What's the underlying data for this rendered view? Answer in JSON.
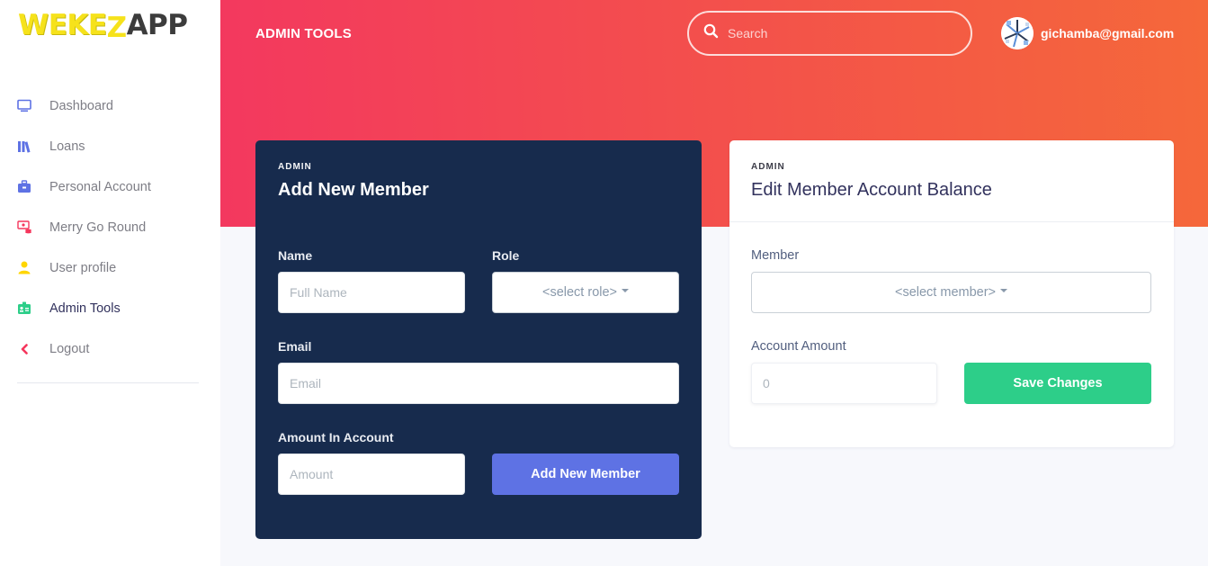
{
  "brand": {
    "part1": "WEKE",
    "part2": "Z",
    "part3": "APP"
  },
  "sidebar": {
    "items": [
      {
        "label": "Dashboard",
        "icon": "monitor-icon",
        "color": "#5e72e4"
      },
      {
        "label": "Loans",
        "icon": "books-icon",
        "color": "#5e72e4"
      },
      {
        "label": "Personal Account",
        "icon": "briefcase-icon",
        "color": "#5e72e4"
      },
      {
        "label": "Merry Go Round",
        "icon": "money-icon",
        "color": "#f5365c"
      },
      {
        "label": "User profile",
        "icon": "user-icon",
        "color": "#ffd600"
      },
      {
        "label": "Admin Tools",
        "icon": "id-card-icon",
        "color": "#2dce89"
      },
      {
        "label": "Logout",
        "icon": "chevron-left-icon",
        "color": "#f5365c"
      }
    ],
    "active": "Admin Tools"
  },
  "header": {
    "title": "ADMIN TOOLS",
    "search_placeholder": "Search",
    "user_email": "gichamba@gmail.com"
  },
  "add_member": {
    "eyebrow": "ADMIN",
    "title": "Add New Member",
    "name_label": "Name",
    "name_placeholder": "Full Name",
    "role_label": "Role",
    "role_selected": "<select role>",
    "email_label": "Email",
    "email_placeholder": "Email",
    "amount_label": "Amount In Account",
    "amount_placeholder": "Amount",
    "submit_label": "Add New Member"
  },
  "edit_balance": {
    "eyebrow": "ADMIN",
    "title": "Edit Member Account Balance",
    "member_label": "Member",
    "member_selected": "<select member>",
    "amount_label": "Account Amount",
    "amount_placeholder": "0",
    "save_label": "Save Changes"
  },
  "colors": {
    "gradient_start": "#f3385f",
    "gradient_end": "#f5683a",
    "dark_card": "#172b4d",
    "primary": "#5e72e4",
    "success": "#2dce89"
  }
}
